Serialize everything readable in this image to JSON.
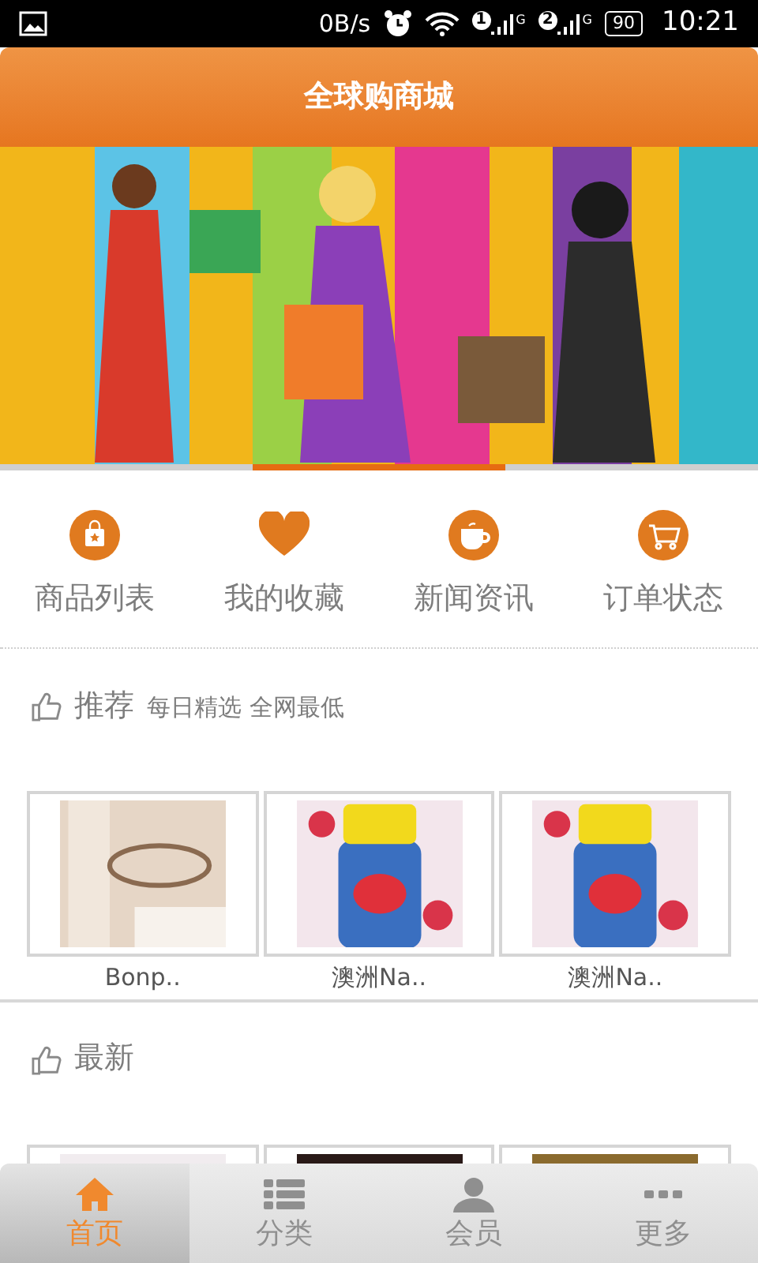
{
  "status_bar": {
    "speed": "0B/s",
    "sims": [
      {
        "slot": "1",
        "network": "G"
      },
      {
        "slot": "2",
        "network": "G"
      }
    ],
    "battery": "90",
    "time": "10:21"
  },
  "header": {
    "title": "全球购商城"
  },
  "banner": {
    "pages": [
      {
        "selected": false
      },
      {
        "selected": true
      },
      {
        "selected": false
      }
    ]
  },
  "shortcuts": [
    {
      "kind": "bag",
      "label": "商品列表"
    },
    {
      "kind": "heart",
      "label": "我的收藏"
    },
    {
      "kind": "cup",
      "label": "新闻资讯"
    },
    {
      "kind": "cart",
      "label": "订单状态"
    }
  ],
  "sections": [
    {
      "title": "推荐",
      "subtitle": "每日精选 全网最低",
      "products": [
        {
          "name": "Bonp..",
          "kind": "picture"
        },
        {
          "name": "澳洲Na..",
          "kind": "picture"
        },
        {
          "name": "澳洲Na..",
          "kind": "picture"
        }
      ]
    },
    {
      "title": "最新"
    }
  ],
  "tab_bar": [
    {
      "kind": "home",
      "label": "首页",
      "selected": true
    },
    {
      "kind": "list",
      "label": "分类",
      "selected": false
    },
    {
      "kind": "user",
      "label": "会员",
      "selected": false
    },
    {
      "kind": "more",
      "label": "更多",
      "selected": false
    }
  ]
}
